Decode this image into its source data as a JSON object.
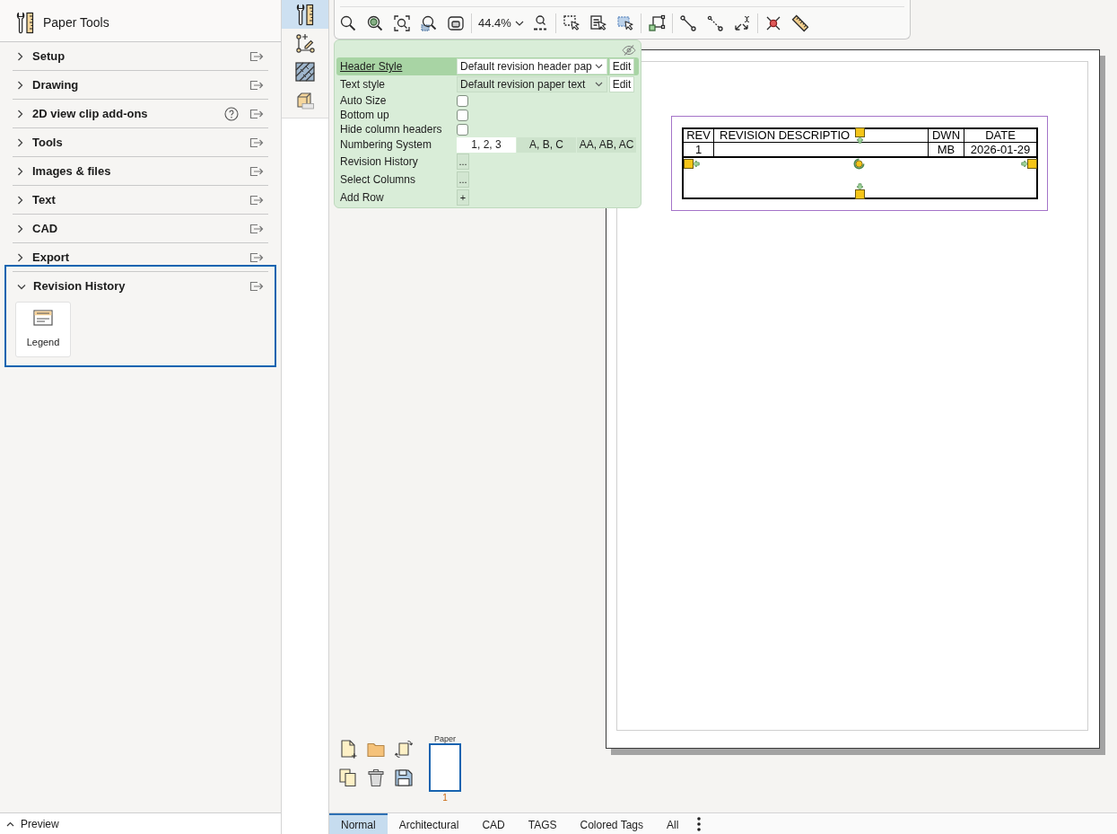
{
  "sidebar": {
    "title": "Paper Tools",
    "sections": [
      {
        "label": "Setup",
        "expanded": false,
        "selected": false,
        "help": false
      },
      {
        "label": "Drawing",
        "expanded": false,
        "selected": false,
        "help": false
      },
      {
        "label": "2D view clip add-ons",
        "expanded": false,
        "selected": false,
        "help": true
      },
      {
        "label": "Tools",
        "expanded": false,
        "selected": false,
        "help": false
      },
      {
        "label": "Images & files",
        "expanded": false,
        "selected": false,
        "help": false
      },
      {
        "label": "Text",
        "expanded": false,
        "selected": false,
        "help": false
      },
      {
        "label": "CAD",
        "expanded": false,
        "selected": false,
        "help": false
      },
      {
        "label": "Export",
        "expanded": false,
        "selected": false,
        "help": false
      },
      {
        "label": "Revision History",
        "expanded": true,
        "selected": true,
        "help": false,
        "tools": [
          {
            "label": "Legend"
          }
        ]
      }
    ],
    "footer": {
      "label": "Preview",
      "expanded": false
    }
  },
  "tool_strip": [
    {
      "kind": "paper-tools",
      "selected": true
    },
    {
      "kind": "dimension",
      "selected": false
    },
    {
      "kind": "hatch",
      "selected": false
    },
    {
      "kind": "pdf",
      "selected": false
    }
  ],
  "toolbar": {
    "zoom": "44.4%"
  },
  "properties": {
    "rows": [
      {
        "kind": "dropdown",
        "label": "Header Style",
        "selected": true,
        "value": "Default revision header pap",
        "button": "Edit"
      },
      {
        "kind": "dropdown",
        "label": "Text style",
        "selected": false,
        "value": "Default revision paper text",
        "button": "Edit"
      },
      {
        "kind": "checkbox",
        "label": "Auto Size",
        "selected": false,
        "checked": false
      },
      {
        "kind": "checkbox",
        "label": "Bottom up",
        "selected": false,
        "checked": false
      },
      {
        "kind": "checkbox",
        "label": "Hide column headers",
        "selected": false,
        "checked": false
      },
      {
        "kind": "segmented",
        "label": "Numbering System",
        "selected": false,
        "options": [
          {
            "label": "1, 2, 3",
            "selected": true
          },
          {
            "label": "A, B, C",
            "selected": false
          },
          {
            "label": "AA, AB, AC",
            "selected": false
          }
        ]
      },
      {
        "kind": "button",
        "label": "Revision History",
        "selected": false,
        "button": "..."
      },
      {
        "kind": "button",
        "label": "Select Columns",
        "selected": false,
        "button": "..."
      },
      {
        "kind": "button",
        "label": "Add Row",
        "selected": false,
        "button": "+"
      }
    ]
  },
  "drawing": {
    "table": {
      "selected": true,
      "columns": [
        "REV",
        "REVISION DESCRIPTIO",
        "DWN",
        "DATE"
      ],
      "rows": [
        {
          "rev": "1",
          "dwn": "MB",
          "date": "2026-01-29"
        }
      ]
    }
  },
  "pages": [
    {
      "label": "Paper",
      "number": "1",
      "selected": true
    }
  ],
  "view_tabs": [
    {
      "label": "Normal",
      "selected": true
    },
    {
      "label": "Architectural",
      "selected": false
    },
    {
      "label": "CAD",
      "selected": false
    },
    {
      "label": "TAGS",
      "selected": false
    },
    {
      "label": "Colored Tags",
      "selected": false
    },
    {
      "label": "All",
      "selected": false
    }
  ]
}
